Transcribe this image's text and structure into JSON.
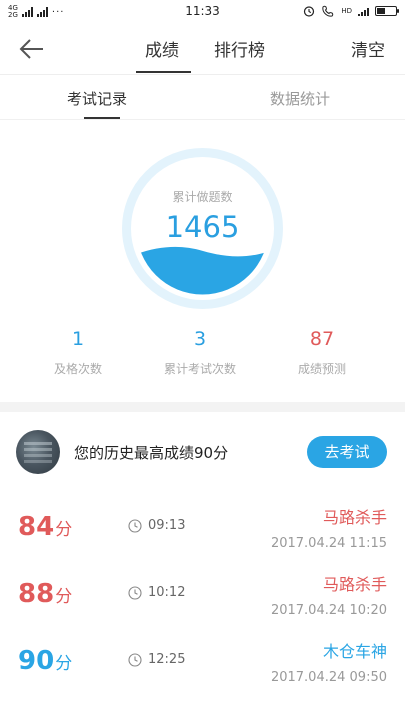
{
  "statusbar": {
    "net_top": "4G",
    "net_bottom": "2G",
    "dots": "···",
    "time": "11:33",
    "hd": "HD"
  },
  "header": {
    "tab_active": "成绩",
    "tab_rank": "排行榜",
    "clear": "清空"
  },
  "subtabs": {
    "records": "考试记录",
    "stats": "数据统计"
  },
  "gauge": {
    "label": "累计做题数",
    "value": "1465"
  },
  "stats": [
    {
      "value": "1",
      "label": "及格次数"
    },
    {
      "value": "3",
      "label": "累计考试次数"
    },
    {
      "value": "87",
      "label": "成绩预测"
    }
  ],
  "best": {
    "text": "您的历史最高成绩90分",
    "button": "去考试"
  },
  "records": [
    {
      "score": "84",
      "unit": "分",
      "duration": "09:13",
      "title": "马路杀手",
      "date": "2017.04.24  11:15",
      "color": "#e05a5a"
    },
    {
      "score": "88",
      "unit": "分",
      "duration": "10:12",
      "title": "马路杀手",
      "date": "2017.04.24  10:20",
      "color": "#e05a5a"
    },
    {
      "score": "90",
      "unit": "分",
      "duration": "12:25",
      "title": "木仓车神",
      "date": "2017.04.24  09:50",
      "color": "#2aa5e4"
    }
  ],
  "colors": {
    "accent": "#2aa5e4",
    "red": "#e05a5a"
  }
}
